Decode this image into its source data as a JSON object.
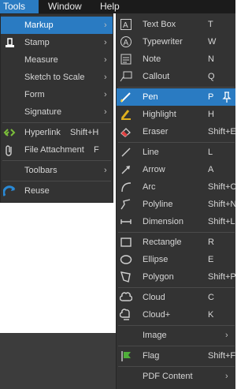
{
  "menubar": {
    "tools": "Tools",
    "window": "Window",
    "help": "Help"
  },
  "tools_menu": [
    {
      "label": "Markup",
      "arrow": "›"
    },
    {
      "label": "Stamp",
      "arrow": "›"
    },
    {
      "label": "Measure",
      "arrow": "›"
    },
    {
      "label": "Sketch to Scale",
      "arrow": "›"
    },
    {
      "label": "Form",
      "arrow": "›"
    },
    {
      "label": "Signature",
      "arrow": "›"
    },
    {
      "label": "Hyperlink",
      "shortcut": "Shift+H"
    },
    {
      "label": "File Attachment",
      "shortcut": "F"
    },
    {
      "label": "Toolbars",
      "arrow": "›"
    },
    {
      "label": "Reuse"
    }
  ],
  "markup_menu": [
    {
      "label": "Text Box",
      "shortcut": "T"
    },
    {
      "label": "Typewriter",
      "shortcut": "W"
    },
    {
      "label": "Note",
      "shortcut": "N"
    },
    {
      "label": "Callout",
      "shortcut": "Q"
    },
    {
      "label": "Pen",
      "shortcut": "P"
    },
    {
      "label": "Highlight",
      "shortcut": "H"
    },
    {
      "label": "Eraser",
      "shortcut": "Shift+E"
    },
    {
      "label": "Line",
      "shortcut": "L"
    },
    {
      "label": "Arrow",
      "shortcut": "A"
    },
    {
      "label": "Arc",
      "shortcut": "Shift+C"
    },
    {
      "label": "Polyline",
      "shortcut": "Shift+N"
    },
    {
      "label": "Dimension",
      "shortcut": "Shift+L"
    },
    {
      "label": "Rectangle",
      "shortcut": "R"
    },
    {
      "label": "Ellipse",
      "shortcut": "E"
    },
    {
      "label": "Polygon",
      "shortcut": "Shift+P"
    },
    {
      "label": "Cloud",
      "shortcut": "C"
    },
    {
      "label": "Cloud+",
      "shortcut": "K"
    },
    {
      "label": "Image",
      "arrow": "›"
    },
    {
      "label": "Flag",
      "shortcut": "Shift+F"
    },
    {
      "label": "PDF Content",
      "arrow": "›"
    }
  ]
}
